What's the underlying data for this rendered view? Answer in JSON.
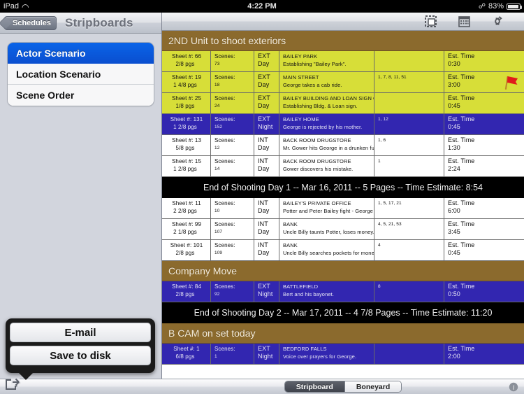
{
  "statusbar": {
    "device": "iPad",
    "time": "4:22 PM",
    "battery": "83%",
    "wifi_icon": "wifi-icon",
    "bluetooth_icon": "bluetooth-icon",
    "battery_icon": "battery-icon"
  },
  "sidebar": {
    "back_label": "Schedules",
    "title": "Stripboards",
    "items": [
      {
        "label": "Actor Scenario",
        "selected": true
      },
      {
        "label": "Location Scenario",
        "selected": false
      },
      {
        "label": "Scene Order",
        "selected": false
      }
    ]
  },
  "toolbar": {
    "icons": [
      {
        "name": "crop-selection-icon"
      },
      {
        "name": "calendar-icon"
      },
      {
        "name": "sync-loop-icon"
      }
    ]
  },
  "popover": {
    "buttons": [
      {
        "label": "E-mail"
      },
      {
        "label": "Save to disk"
      }
    ],
    "anchor_icon": "share-icon"
  },
  "bottom": {
    "segments": [
      {
        "label": "Stripboard",
        "selected": true
      },
      {
        "label": "Boneyard",
        "selected": false
      }
    ],
    "info_icon": "info-icon"
  },
  "board": {
    "column_headers": {
      "sheet": "Sheet #:",
      "scenes": "Scenes:",
      "pages_suffix": "pgs",
      "est_time": "Est. Time"
    },
    "rows": [
      {
        "kind": "banner",
        "text": "2ND Unit to shoot exteriors"
      },
      {
        "kind": "strip",
        "style": "ext-day",
        "sheet": "Sheet #: 66",
        "pages": "2/8 pgs",
        "scenes_label": "Scenes:",
        "scenes": "73",
        "int_ext": "EXT",
        "day_night": "Day",
        "location": "BAILEY PARK",
        "description": "Establishing \"Bailey Park\".",
        "cast": "",
        "time_label": "Est. Time",
        "time": "0:30",
        "flag": false
      },
      {
        "kind": "strip",
        "style": "ext-day",
        "sheet": "Sheet #: 19",
        "pages": "1 4/8 pgs",
        "scenes_label": "Scenes:",
        "scenes": "18",
        "int_ext": "EXT",
        "day_night": "Day",
        "location": "MAIN STREET",
        "description": "George takes a cab ride.",
        "cast": "1, 7, 8, 11, 51",
        "time_label": "Est. Time",
        "time": "3:00",
        "flag": true
      },
      {
        "kind": "strip",
        "style": "ext-day",
        "sheet": "Sheet #: 25",
        "pages": "1/8 pgs",
        "scenes_label": "Scenes:",
        "scenes": "24",
        "int_ext": "EXT",
        "day_night": "Day",
        "location": "BAILEY BUILDING AND LOAN SIGN OVER ENTRANCE",
        "description": "Establishing Bldg. & Loan sign.",
        "cast": "",
        "time_label": "Est. Time",
        "time": "0:45",
        "flag": false
      },
      {
        "kind": "strip",
        "style": "ext-night",
        "sheet": "Sheet #: 131",
        "pages": "1 2/8 pgs",
        "scenes_label": "Scenes:",
        "scenes": "152",
        "int_ext": "EXT",
        "day_night": "Night",
        "location": "BAILEY HOME",
        "description": "George is rejected by his mother.",
        "cast": "1, 12",
        "time_label": "Est. Time",
        "time": "0:45",
        "flag": false
      },
      {
        "kind": "strip",
        "style": "int-day",
        "sheet": "Sheet #: 13",
        "pages": "5/8 pgs",
        "scenes_label": "Scenes:",
        "scenes": "12",
        "int_ext": "INT",
        "day_night": "Day",
        "location": "BACK ROOM DRUGSTORE",
        "description": "Mr. Gower hits George in a drunken fury.",
        "cast": "1, 6",
        "time_label": "Est. Time",
        "time": "1:30",
        "flag": false
      },
      {
        "kind": "strip",
        "style": "int-day",
        "sheet": "Sheet #: 15",
        "pages": "1 2/8 pgs",
        "scenes_label": "Scenes:",
        "scenes": "14",
        "int_ext": "INT",
        "day_night": "Day",
        "location": "BACK ROOM DRUGSTORE",
        "description": "Gower discovers his mistake.",
        "cast": "1",
        "time_label": "Est. Time",
        "time": "2:24",
        "flag": false
      },
      {
        "kind": "daybreak",
        "text": "End of Shooting Day 1 -- Mar 16, 2011 -- 5 Pages -- Time Estimate: 8:54"
      },
      {
        "kind": "strip",
        "style": "int-day",
        "sheet": "Sheet #: 11",
        "pages": "2 2/8 pgs",
        "scenes_label": "Scenes:",
        "scenes": "10",
        "int_ext": "INT",
        "day_night": "Day",
        "location": "BAILEY'S PRIVATE OFFICE",
        "description": "Potter and Peter Bailey fight - George intervenes.",
        "cast": "1, 5, 17, 21",
        "time_label": "Est. Time",
        "time": "6:00",
        "flag": false
      },
      {
        "kind": "strip",
        "style": "int-day",
        "sheet": "Sheet #: 99",
        "pages": "2 1/8 pgs",
        "scenes_label": "Scenes:",
        "scenes": "107",
        "int_ext": "INT",
        "day_night": "Day",
        "location": "BANK",
        "description": "Uncle Billy taunts Potter, loses money.",
        "cast": "4, 5, 21, 53",
        "time_label": "Est. Time",
        "time": "3:45",
        "flag": false
      },
      {
        "kind": "strip",
        "style": "int-day",
        "sheet": "Sheet #: 101",
        "pages": "2/8 pgs",
        "scenes_label": "Scenes:",
        "scenes": "109",
        "int_ext": "INT",
        "day_night": "Day",
        "location": "BANK",
        "description": "Uncle Billy searches pockets for money.",
        "cast": "4",
        "time_label": "Est. Time",
        "time": "0:45",
        "flag": false
      },
      {
        "kind": "banner",
        "text": "Company Move"
      },
      {
        "kind": "strip",
        "style": "ext-night",
        "sheet": "Sheet #: 84",
        "pages": "2/8 pgs",
        "scenes_label": "Scenes:",
        "scenes": "92",
        "int_ext": "EXT",
        "day_night": "Night",
        "location": "BATTLEFIELD",
        "description": "Bert and his bayonet.",
        "cast": "8",
        "time_label": "Est. Time",
        "time": "0:50",
        "flag": false
      },
      {
        "kind": "daybreak",
        "text": "End of Shooting Day 2 -- Mar 17, 2011 -- 4 7/8 Pages -- Time Estimate: 11:20"
      },
      {
        "kind": "banner",
        "text": "B CAM  on set today"
      },
      {
        "kind": "strip",
        "style": "ext-night",
        "sheet": "Sheet #: 1",
        "pages": "6/8 pgs",
        "scenes_label": "Scenes:",
        "scenes": "1",
        "int_ext": "EXT",
        "day_night": "Night",
        "location": "BEDFORD FALLS",
        "description": "Voice over prayers for George.",
        "cast": "",
        "time_label": "Est. Time",
        "time": "2:00",
        "flag": false
      }
    ]
  },
  "colors": {
    "ext_day": "#d7de38",
    "ext_night": "#3226b0",
    "int_day": "#ffffff",
    "banner": "#8b6a2d",
    "daybreak": "#000000",
    "selection": "#0a4fd0",
    "flag": "#e01b1b"
  }
}
